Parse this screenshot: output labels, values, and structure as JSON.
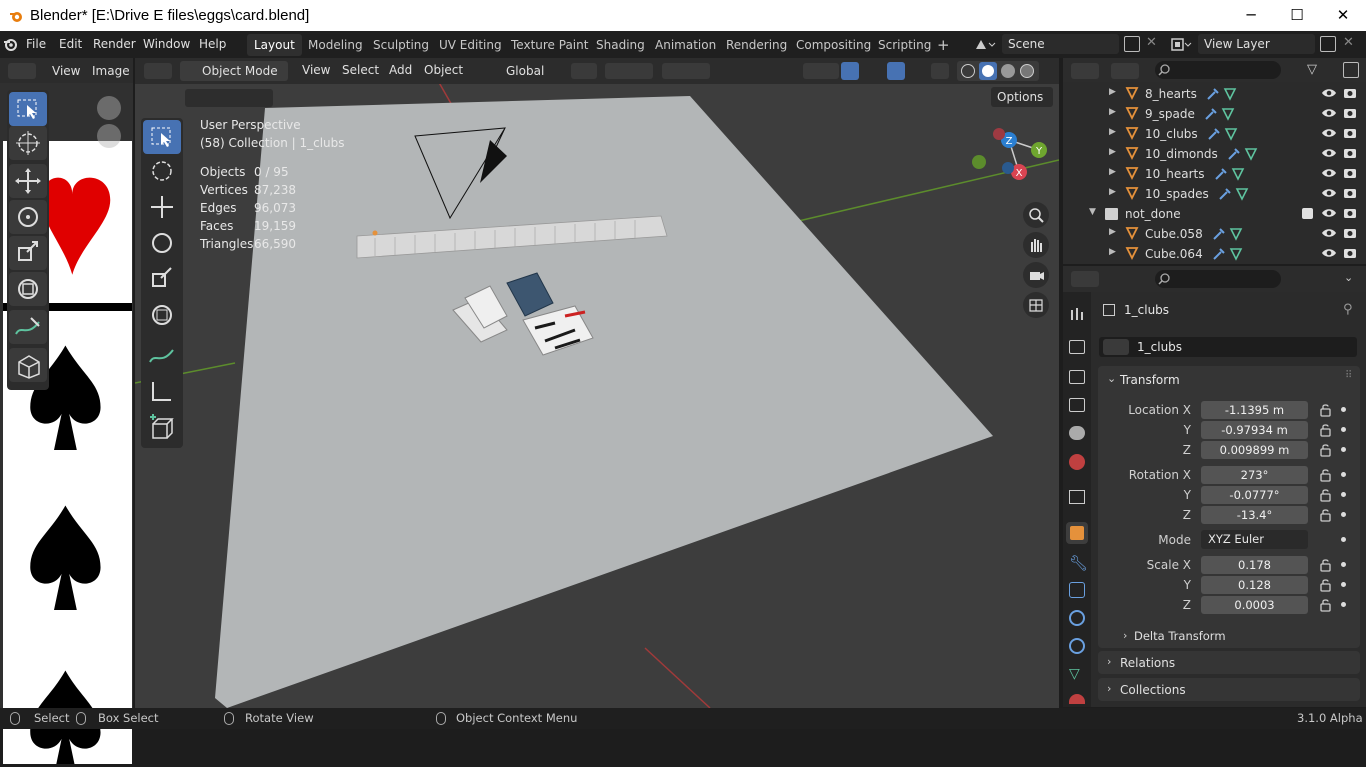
{
  "window": {
    "title": "Blender* [E:\\Drive E files\\eggs\\card.blend]",
    "minimize_glyph": "─",
    "maximize_glyph": "☐",
    "close_glyph": "✕"
  },
  "menu": [
    "File",
    "Edit",
    "Render",
    "Window",
    "Help"
  ],
  "workspaces": [
    "Layout",
    "Modeling",
    "Sculpting",
    "UV Editing",
    "Texture Paint",
    "Shading",
    "Animation",
    "Rendering",
    "Compositing",
    "Scripting"
  ],
  "add_workspace": "+",
  "scene": {
    "value": "Scene"
  },
  "view_layer": {
    "value": "View Layer"
  },
  "image_editor": {
    "view": "View",
    "image": "Image"
  },
  "viewport": {
    "mode": "Object Mode",
    "menus": [
      "View",
      "Select",
      "Add",
      "Object"
    ],
    "orientation": "Global",
    "options": "Options",
    "perspective": "User Perspective",
    "collection": "(58) Collection | 1_clubs",
    "stats": [
      {
        "label": "Objects",
        "value": "0 / 95"
      },
      {
        "label": "Vertices",
        "value": "87,238"
      },
      {
        "label": "Edges",
        "value": "96,073"
      },
      {
        "label": "Faces",
        "value": "19,159"
      },
      {
        "label": "Triangles",
        "value": "66,590"
      }
    ],
    "gizmo": {
      "x": "X",
      "y": "Y",
      "z": "Z"
    }
  },
  "outliner": {
    "items": [
      {
        "name": "8_hearts"
      },
      {
        "name": "9_spade"
      },
      {
        "name": "10_clubs"
      },
      {
        "name": "10_dimonds"
      },
      {
        "name": "10_hearts"
      },
      {
        "name": "10_spades"
      },
      {
        "name": "not_done"
      },
      {
        "name": "Cube.058"
      },
      {
        "name": "Cube.064"
      }
    ]
  },
  "properties": {
    "object_name": "1_clubs",
    "datablock": "1_clubs",
    "transform": {
      "title": "Transform",
      "location_label": "Location X",
      "location": [
        "-1.1395 m",
        "-0.97934 m",
        "0.009899 m"
      ],
      "rotation_label": "Rotation X",
      "rotation": [
        "273°",
        "-0.0777°",
        "-13.4°"
      ],
      "mode_label": "Mode",
      "mode": "XYZ Euler",
      "scale_label": "Scale X",
      "scale": [
        "0.178",
        "0.128",
        "0.0003"
      ],
      "y": "Y",
      "z": "Z"
    },
    "delta_transform": "Delta Transform",
    "relations": "Relations",
    "collections": "Collections"
  },
  "statusbar": {
    "select": "Select",
    "box_select": "Box Select",
    "rotate_view": "Rotate View",
    "context_menu": "Object Context Menu",
    "version": "3.1.0 Alpha"
  },
  "colors": {
    "accent": "#4772b3",
    "object_orange": "#e5913b",
    "mesh_green": "#5ec39f"
  }
}
